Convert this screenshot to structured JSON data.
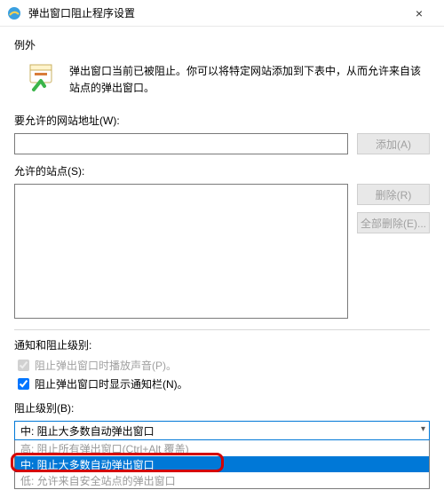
{
  "window": {
    "title": "弹出窗口阻止程序设置",
    "close": "×"
  },
  "exceptions": {
    "heading": "例外",
    "info_text": "弹出窗口当前已被阻止。你可以将特定网站添加到下表中，从而允许来自该站点的弹出窗口。",
    "address_label": "要允许的网站地址(W):",
    "address_value": "",
    "add_btn": "添加(A)",
    "sites_label": "允许的站点(S):",
    "remove_btn": "删除(R)",
    "remove_all_btn": "全部删除(E)..."
  },
  "notify": {
    "heading": "通知和阻止级别:",
    "sound_label": "阻止弹出窗口时播放声音(P)。",
    "sound_checked": true,
    "notifbar_label": "阻止弹出窗口时显示通知栏(N)。",
    "notifbar_checked": true,
    "level_label": "阻止级别(B):",
    "level_selected": "中: 阻止大多数自动弹出窗口",
    "level_options": {
      "high": "高: 阻止所有弹出窗口(Ctrl+Alt 覆盖)",
      "medium": "中: 阻止大多数自动弹出窗口",
      "low": "低: 允许来自安全站点的弹出窗口"
    }
  }
}
